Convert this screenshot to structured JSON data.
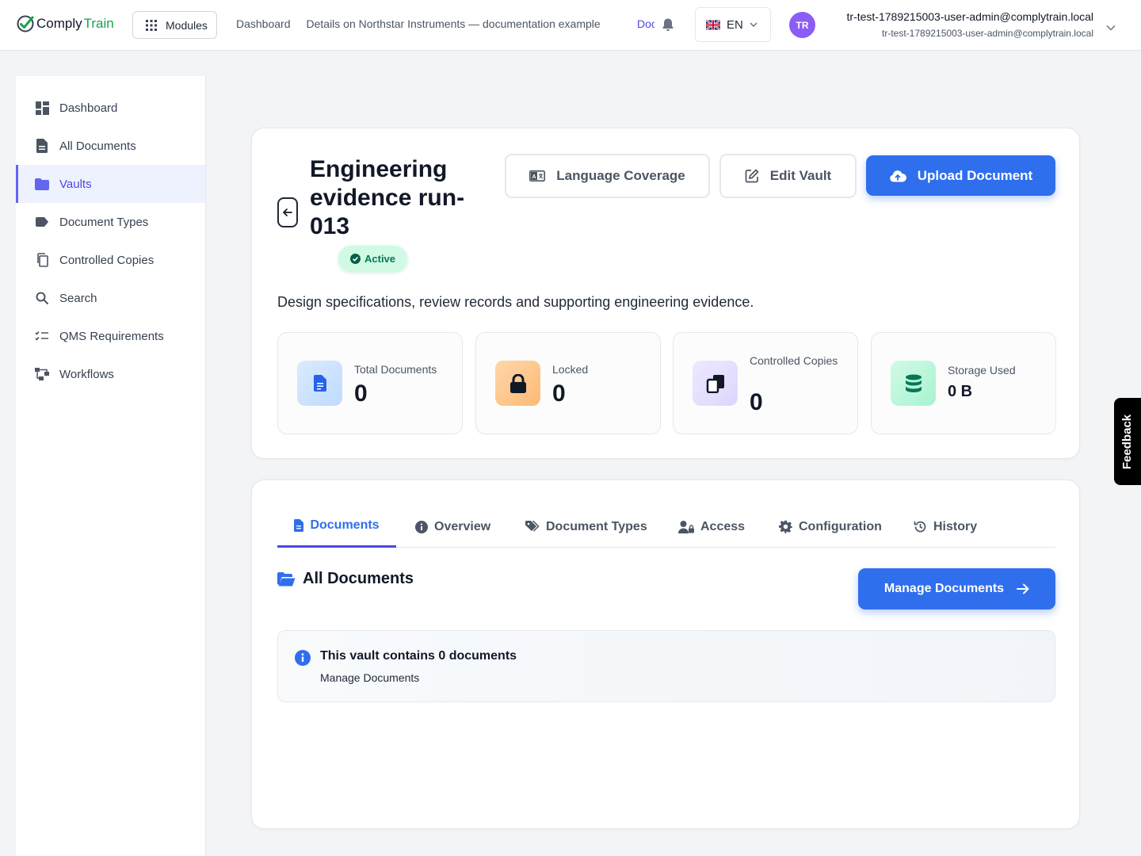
{
  "brand": {
    "name_part1": "Comply",
    "name_part2": "Train"
  },
  "topbar": {
    "modules_label": "Modules",
    "breadcrumbs": [
      "Dashboard",
      "Details on Northstar Instruments — documentation example"
    ],
    "breadcrumb_truncated": "Doc",
    "language": "EN",
    "user_initials": "TR",
    "user_name": "tr-test-1789215003-user-admin@complytrain.local",
    "user_email": "tr-test-1789215003-user-admin@complytrain.local"
  },
  "sidebar": {
    "items": [
      {
        "label": "Dashboard",
        "icon": "dashboard-icon"
      },
      {
        "label": "All Documents",
        "icon": "document-icon"
      },
      {
        "label": "Vaults",
        "icon": "folder-icon",
        "active": true
      },
      {
        "label": "Document Types",
        "icon": "tag-icon"
      },
      {
        "label": "Controlled Copies",
        "icon": "copy-icon"
      },
      {
        "label": "Search",
        "icon": "search-icon"
      },
      {
        "label": "QMS Requirements",
        "icon": "checklist-icon"
      },
      {
        "label": "Workflows",
        "icon": "workflow-icon"
      }
    ]
  },
  "vault": {
    "title": "Engineering evidence run-013",
    "status": "Active",
    "description": "Design specifications, review records and supporting engineering evidence.",
    "buttons": {
      "language_coverage": "Language Coverage",
      "edit_vault": "Edit Vault",
      "upload_document": "Upload Document"
    },
    "stats": [
      {
        "label": "Total Documents",
        "value": "0",
        "color": "#2563eb"
      },
      {
        "label": "Locked",
        "value": "0",
        "color": "#f59e0b"
      },
      {
        "label": "Controlled Copies",
        "value": "0",
        "color": "#8b5cf6"
      },
      {
        "label": "Storage Used",
        "value": "0 B",
        "color": "#10b981"
      }
    ]
  },
  "tabs": [
    {
      "label": "Documents",
      "active": true
    },
    {
      "label": "Overview"
    },
    {
      "label": "Document Types"
    },
    {
      "label": "Access"
    },
    {
      "label": "Configuration"
    },
    {
      "label": "History"
    }
  ],
  "documents_section": {
    "title": "All Documents",
    "manage_button": "Manage Documents",
    "info_title": "This vault contains 0 documents",
    "info_subtitle": "Manage Documents"
  },
  "feedback_label": "Feedback",
  "colors": {
    "primary": "#2f6fed",
    "accent": "#4f46e5",
    "success": "#047857"
  }
}
